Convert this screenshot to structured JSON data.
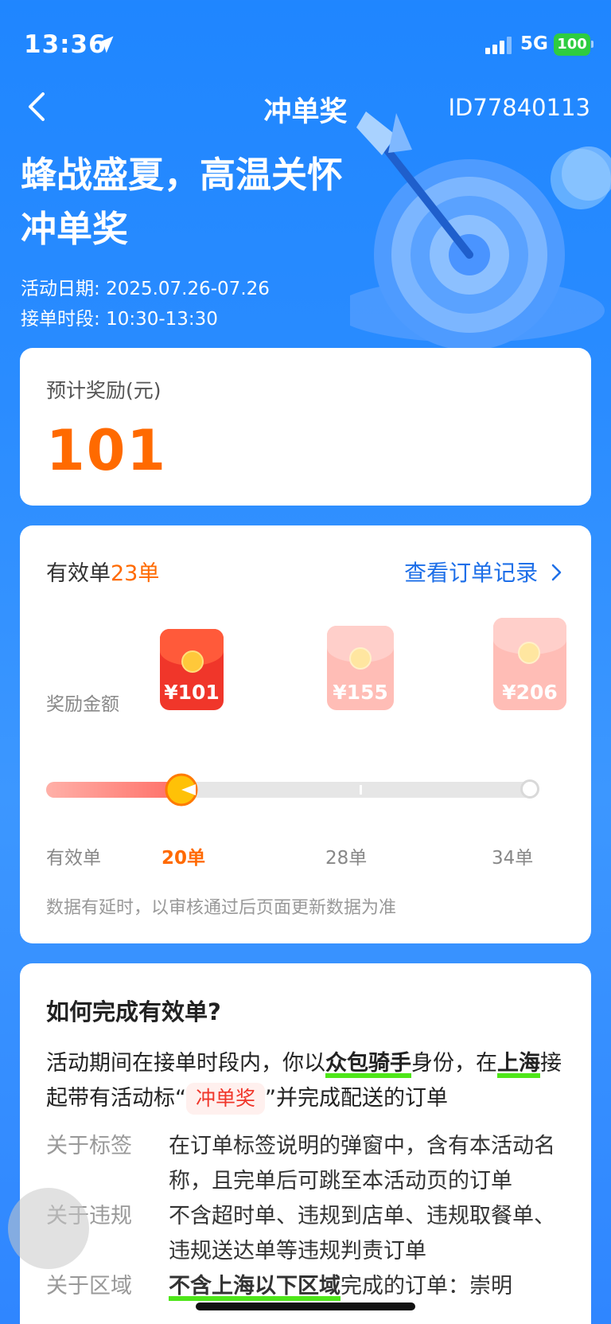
{
  "status_bar": {
    "time": "13:36",
    "network": "5G",
    "battery": "100"
  },
  "nav": {
    "title": "冲单奖",
    "id": "ID77840113"
  },
  "hero": {
    "title_line1": "蜂战盛夏，高温关怀",
    "title_line2": "冲单奖",
    "date_label": "活动日期:",
    "date_value": "2025.07.26-07.26",
    "period_label": "接单时段:",
    "period_value": "10:30-13:30"
  },
  "reward": {
    "label": "预计奖励(元)",
    "value": "101"
  },
  "progress": {
    "valid_label": "有效单",
    "valid_count": "23单",
    "view_records": "查看订单记录",
    "bonus_label": "奖励金额",
    "tiers": [
      {
        "amount": "¥101",
        "threshold": "20单",
        "active": true
      },
      {
        "amount": "¥155",
        "threshold": "28单",
        "active": false
      },
      {
        "amount": "¥206",
        "threshold": "34单",
        "active": false
      }
    ],
    "axis_label": "有效单",
    "progress_fraction": 0.276,
    "note": "数据有延时，以审核通过后页面更新数据为准"
  },
  "howto": {
    "title": "如何完成有效单?",
    "desc_part1": "活动期间在接单时段内，你以",
    "desc_hl1": "众包骑手",
    "desc_part2": "身份，在",
    "desc_hl2": "上海",
    "desc_part3": "接起带有活动标“",
    "desc_tag": "冲单奖",
    "desc_part4": "”并完成配送的订单",
    "rules": [
      {
        "key": "关于标签",
        "value": "在订单标签说明的弹窗中，含有本活动名称，且完单后可跳至本活动页的订单"
      },
      {
        "key": "关于违规",
        "value": "不含超时单、违规到店单、违规取餐单、违规送达单等违规判责订单"
      },
      {
        "key": "关于区域",
        "value_hl": "不含上海以下区域",
        "value_rest": "完成的订单：崇明"
      }
    ]
  },
  "colors": {
    "accent": "#ff6a00",
    "link": "#1e6fe8",
    "background": "#2a8cff",
    "highlight": "#4ee619"
  }
}
